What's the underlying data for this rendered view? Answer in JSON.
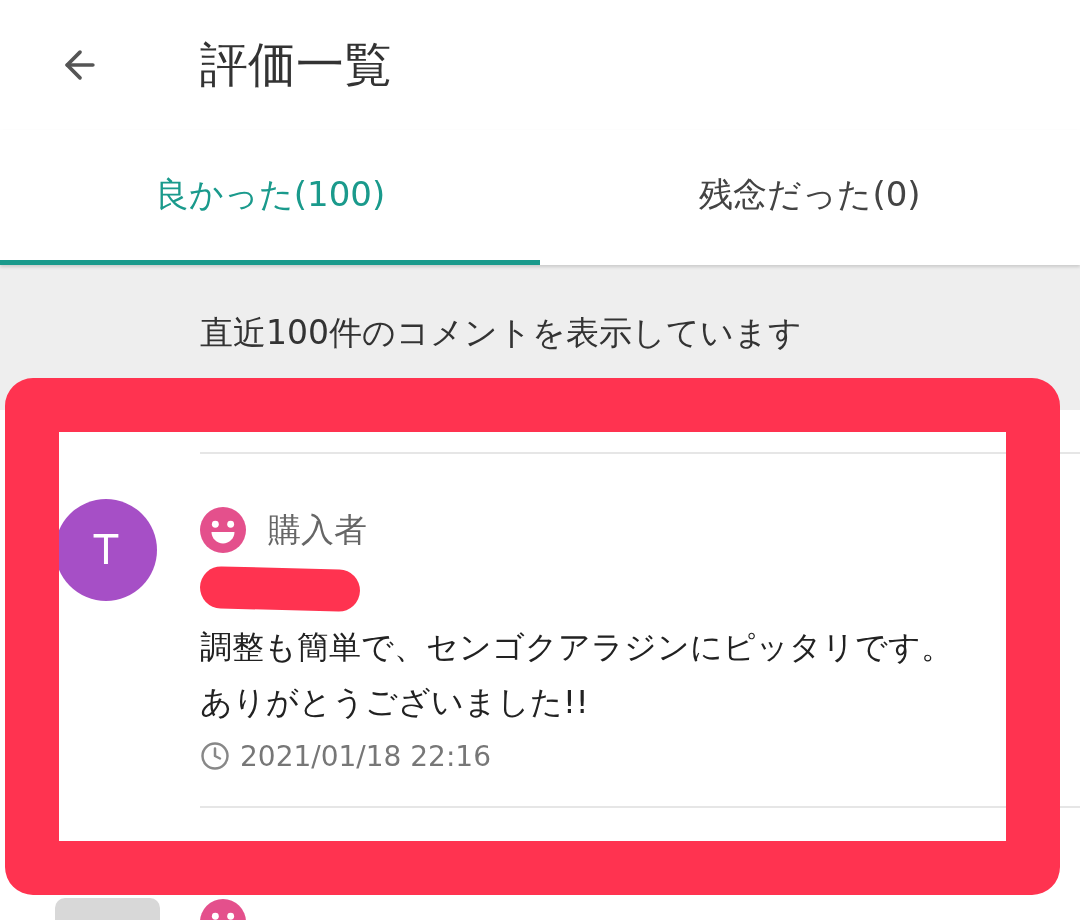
{
  "header": {
    "title": "評価一覧"
  },
  "tabs": [
    {
      "label": "良かった(100)",
      "selected": true
    },
    {
      "label": "残念だった(0)",
      "selected": false
    }
  ],
  "notice": "直近100件のコメントを表示しています",
  "reviews": [
    {
      "kind": "full",
      "avatar": "T",
      "color": "#a64fc6",
      "role": "購入者",
      "name_redacted": true,
      "comment": [
        "調整も簡単で、センゴクアラジンにピッタリです。",
        "ありがとうございました!!"
      ],
      "time": "2021/01/18 22:16"
    },
    {
      "kind": "cut"
    }
  ],
  "highlight": {
    "shown": true
  }
}
